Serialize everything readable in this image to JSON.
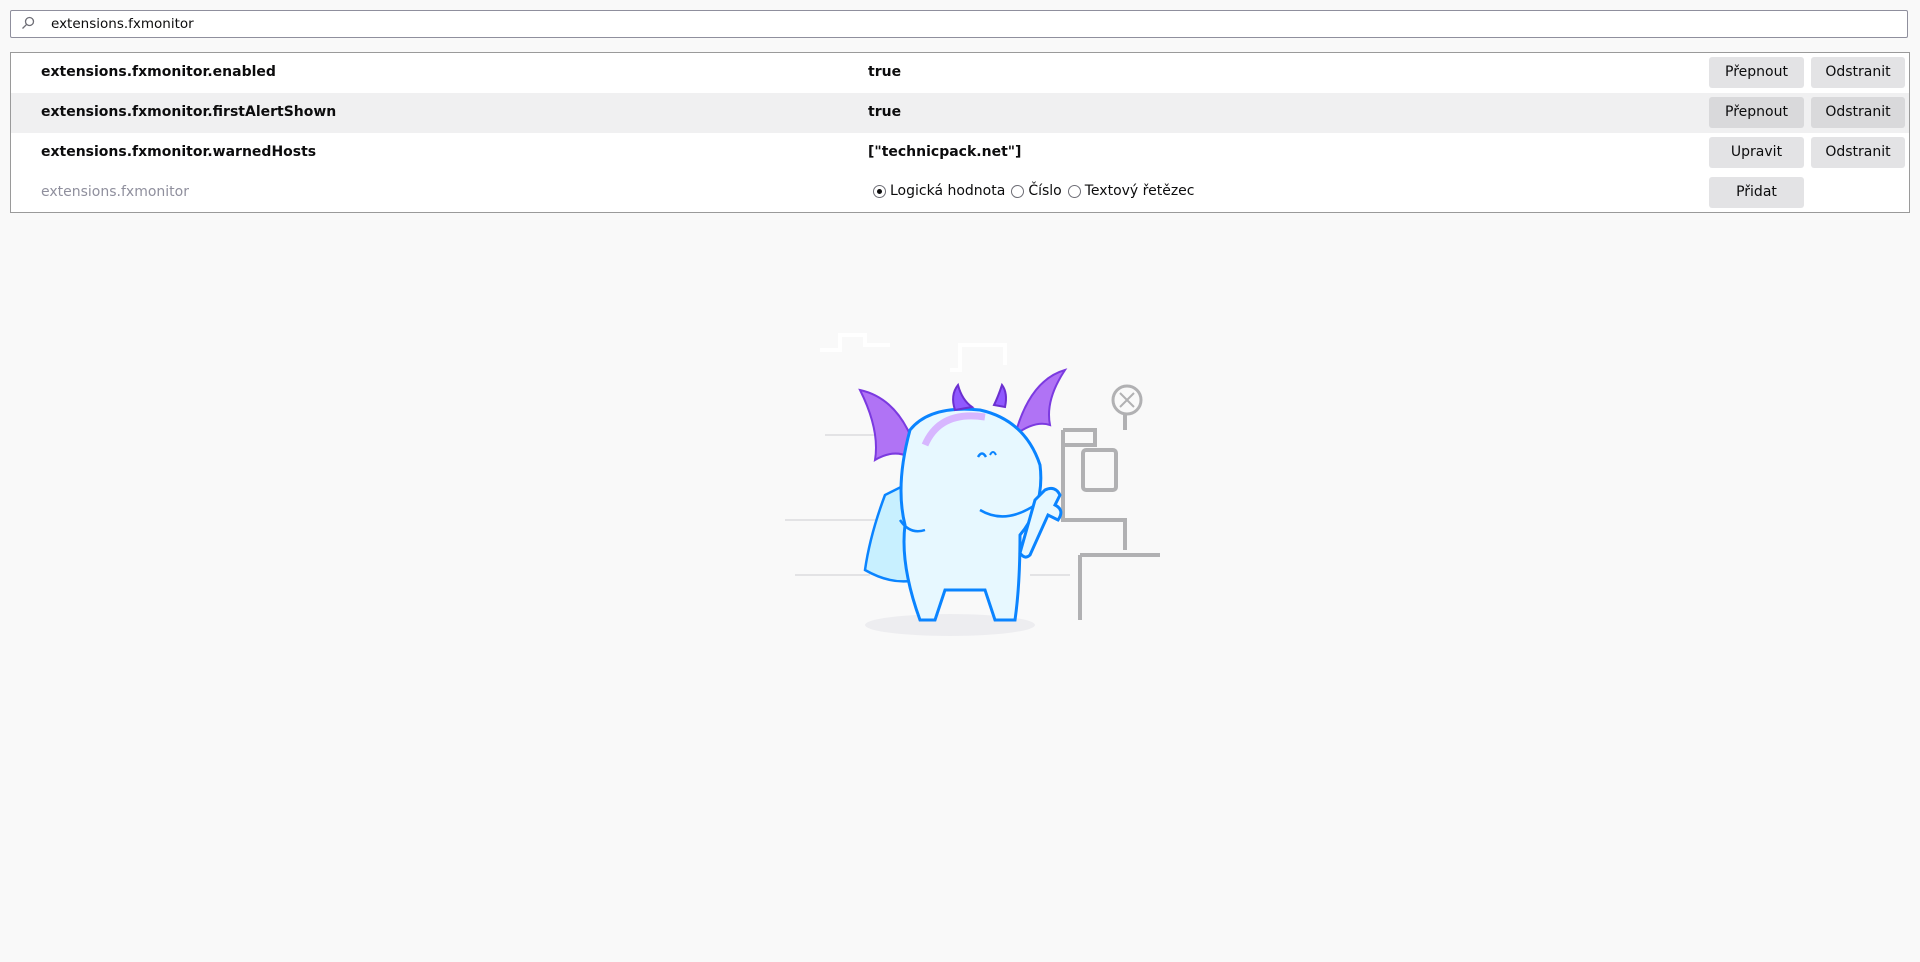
{
  "search": {
    "value": "extensions.fxmonitor"
  },
  "prefs": [
    {
      "name": "extensions.fxmonitor.enabled",
      "value": "true",
      "action_label": "Přepnout",
      "remove_label": "Odstranit"
    },
    {
      "name": "extensions.fxmonitor.firstAlertShown",
      "value": "true",
      "action_label": "Přepnout",
      "remove_label": "Odstranit"
    },
    {
      "name": "extensions.fxmonitor.warnedHosts",
      "value": "[\"technicpack.net\"]",
      "action_label": "Upravit",
      "remove_label": "Odstranit"
    }
  ],
  "new_pref": {
    "name": "extensions.fxmonitor",
    "types": [
      {
        "label": "Logická hodnota",
        "selected": true
      },
      {
        "label": "Číslo",
        "selected": false
      },
      {
        "label": "Textový řetězec",
        "selected": false
      }
    ],
    "add_label": "Přidat"
  },
  "icons": {
    "search": "search-icon",
    "illustration": "dino-mechanic-illustration"
  },
  "colors": {
    "accent_purple": "#9059ff",
    "accent_blue": "#0a84ff"
  }
}
